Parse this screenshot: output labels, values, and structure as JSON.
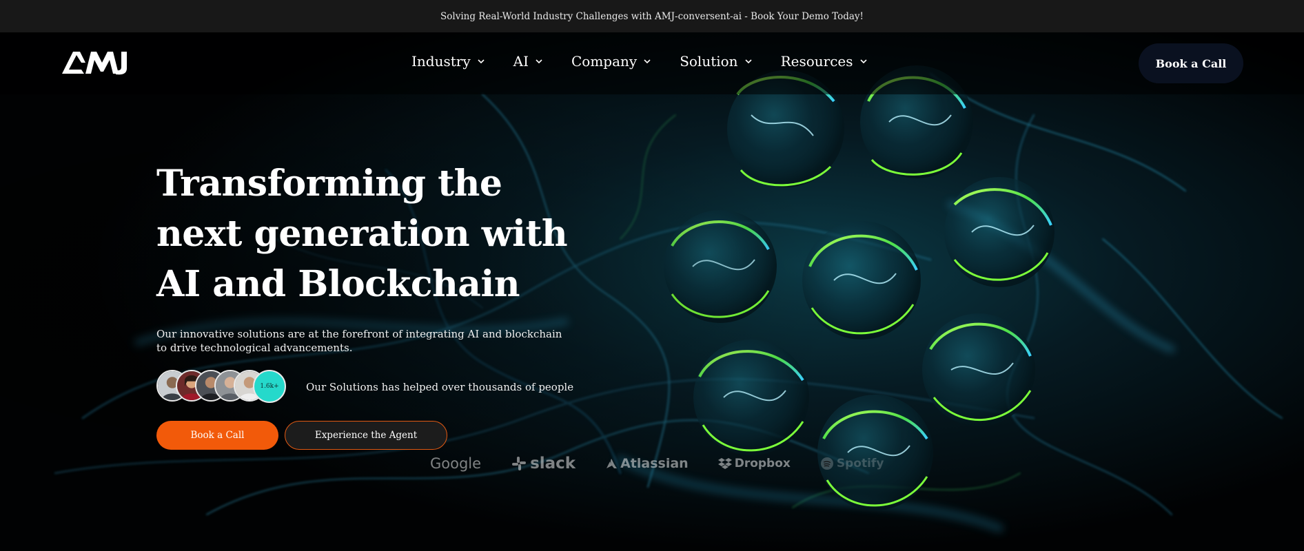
{
  "announcement": {
    "text": "Solving Real-World Industry Challenges with AMJ-conversent-ai - Book Your Demo Today!"
  },
  "header": {
    "logo_alt": "AMJ",
    "nav": [
      {
        "label": "Industry",
        "icon": "chevron-down-icon"
      },
      {
        "label": "AI",
        "icon": "chevron-down-icon"
      },
      {
        "label": "Company",
        "icon": "chevron-down-icon"
      },
      {
        "label": "Solution",
        "icon": "chevron-down-icon"
      },
      {
        "label": "Resources",
        "icon": "chevron-down-icon"
      }
    ],
    "cta_label": "Book a Call"
  },
  "hero": {
    "headline": "Transforming the next generation with AI and Blockchain",
    "subtext": "Our innovative solutions are at the forefront of integrating AI and blockchain to drive technological advancements.",
    "avatar_count_label": "1.6k+",
    "social_proof": "Our Solutions has helped over thousands of people",
    "primary_cta": "Book a Call",
    "secondary_cta": "Experience the Agent"
  },
  "partners": [
    {
      "name": "Google"
    },
    {
      "name": "slack"
    },
    {
      "name": "Atlassian"
    },
    {
      "name": "Dropbox"
    },
    {
      "name": "Spotify"
    }
  ],
  "colors": {
    "accent": "#f25a0a",
    "nav_cta_bg": "#0a1120",
    "avatar_count_bg": "#25d9cb",
    "announce_bg": "#181818",
    "glow_green": "#7cff3a",
    "glow_cyan": "#35c8ff"
  }
}
